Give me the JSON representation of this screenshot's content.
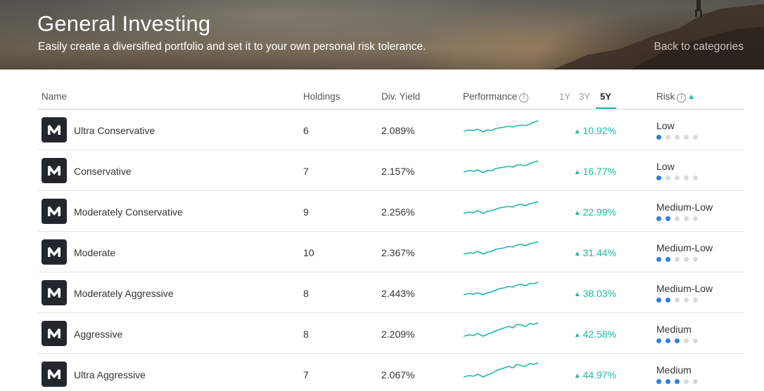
{
  "header": {
    "title": "General Investing",
    "subtitle": "Easily create a diversified portfolio and set it to your own personal risk tolerance.",
    "back_link": "Back to categories"
  },
  "columns": {
    "name": "Name",
    "holdings": "Holdings",
    "div_yield": "Div. Yield",
    "performance": "Performance",
    "risk": "Risk"
  },
  "periods": [
    "1Y",
    "3Y",
    "5Y"
  ],
  "active_period": "5Y",
  "colors": {
    "accent": "#1fb8a6",
    "risk_on": "#2f7fd8",
    "risk_off": "#d8dbde",
    "logo_bg": "#23272d"
  },
  "icons": {
    "logo": "m1-logo-icon",
    "info": "info-circle-icon",
    "sort": "sort-ascending-icon",
    "up": "triangle-up-icon"
  },
  "portfolios": [
    {
      "name": "Ultra Conservative",
      "holdings": "6",
      "div_yield": "2.089%",
      "performance": "10.92%",
      "risk_label": "Low",
      "risk_level": 1
    },
    {
      "name": "Conservative",
      "holdings": "7",
      "div_yield": "2.157%",
      "performance": "16.77%",
      "risk_label": "Low",
      "risk_level": 1
    },
    {
      "name": "Moderately Conservative",
      "holdings": "9",
      "div_yield": "2.256%",
      "performance": "22.99%",
      "risk_label": "Medium-Low",
      "risk_level": 2
    },
    {
      "name": "Moderate",
      "holdings": "10",
      "div_yield": "2.367%",
      "performance": "31.44%",
      "risk_label": "Medium-Low",
      "risk_level": 2
    },
    {
      "name": "Moderately Aggressive",
      "holdings": "8",
      "div_yield": "2.443%",
      "performance": "38.03%",
      "risk_label": "Medium-Low",
      "risk_level": 2
    },
    {
      "name": "Aggressive",
      "holdings": "8",
      "div_yield": "2.209%",
      "performance": "42.58%",
      "risk_label": "Medium",
      "risk_level": 3
    },
    {
      "name": "Ultra Aggressive",
      "holdings": "7",
      "div_yield": "2.067%",
      "performance": "44.97%",
      "risk_label": "Medium",
      "risk_level": 3
    }
  ]
}
